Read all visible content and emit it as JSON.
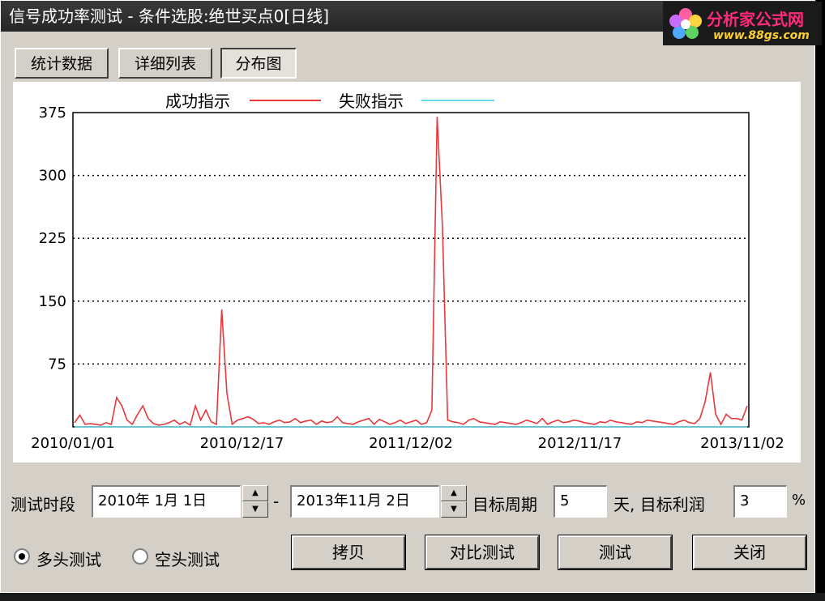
{
  "window": {
    "title": "信号成功率测试 - 条件选股:绝世买点0[日线]"
  },
  "watermark": {
    "brand": "分析家公式网",
    "url": "www.88gs.com"
  },
  "tabs": [
    {
      "label": "统计数据",
      "active": false
    },
    {
      "label": "详细列表",
      "active": false
    },
    {
      "label": "分布图",
      "active": true
    }
  ],
  "chart": {
    "legend": {
      "success": "成功指示",
      "fail": "失败指示"
    },
    "yticks": [
      "375",
      "300",
      "225",
      "150",
      "75"
    ],
    "xticks": [
      "2010/01/01",
      "2010/12/17",
      "2011/12/02",
      "2012/11/17",
      "2013/11/02"
    ]
  },
  "chart_data": {
    "type": "line",
    "ylim": [
      0,
      375
    ],
    "grid": true,
    "legend_position": "top",
    "x": [
      "2010/01/01",
      "2010/12/17",
      "2011/12/02",
      "2012/11/17",
      "2013/11/02"
    ],
    "series": [
      {
        "name": "成功指示",
        "color": "#e8383c",
        "values": [
          5,
          14,
          3,
          4,
          3,
          2,
          5,
          3,
          35,
          25,
          8,
          3,
          15,
          25,
          10,
          4,
          2,
          3,
          5,
          8,
          3,
          6,
          2,
          25,
          8,
          20,
          6,
          3,
          140,
          40,
          3,
          8,
          10,
          12,
          9,
          4,
          5,
          3,
          6,
          8,
          5,
          6,
          10,
          5,
          7,
          8,
          3,
          7,
          5,
          6,
          12,
          5,
          4,
          3,
          6,
          8,
          10,
          3,
          9,
          6,
          3,
          5,
          8,
          4,
          6,
          8,
          3,
          5,
          20,
          370,
          240,
          8,
          6,
          5,
          3,
          8,
          10,
          6,
          5,
          4,
          3,
          6,
          5,
          4,
          3,
          5,
          8,
          6,
          4,
          10,
          3,
          6,
          8,
          5,
          6,
          8,
          7,
          5,
          4,
          3,
          6,
          5,
          8,
          6,
          5,
          4,
          3,
          6,
          5,
          8,
          7,
          6,
          5,
          4,
          3,
          6,
          8,
          5,
          4,
          10,
          30,
          65,
          15,
          3,
          15,
          10,
          10,
          8,
          25
        ]
      },
      {
        "name": "失败指示",
        "color": "#63dcea",
        "values": [
          0,
          0,
          0,
          0,
          0,
          0,
          0,
          0,
          0,
          0,
          0,
          0,
          0,
          0,
          0,
          0,
          0,
          0,
          0,
          0,
          0,
          0,
          0,
          0,
          0,
          0,
          0,
          0,
          0,
          0,
          0,
          0,
          0,
          0,
          0,
          0,
          0,
          0,
          0,
          0,
          0,
          0,
          0,
          0,
          0,
          0,
          0,
          0,
          0,
          0,
          0,
          0,
          0,
          0,
          0,
          0,
          0,
          0,
          0,
          0,
          0,
          0,
          0,
          0,
          0,
          0,
          0,
          0,
          0,
          0,
          0,
          0,
          0,
          0,
          0,
          0,
          0,
          0,
          0,
          0,
          0,
          0,
          0,
          0,
          0,
          0,
          0,
          0,
          0,
          0,
          0,
          0,
          0,
          0,
          0,
          0,
          0,
          0,
          0,
          0,
          0,
          0,
          0,
          0,
          0,
          0,
          0,
          0,
          0,
          0,
          0,
          0,
          0,
          0,
          0,
          0,
          0,
          0,
          0,
          0,
          0,
          0,
          0,
          0,
          0,
          0,
          0,
          0
        ]
      }
    ]
  },
  "form": {
    "period_label": "测试时段",
    "start_date": "2010年 1月 1日",
    "dash": "-",
    "end_date": "2013年11月 2日",
    "target_period_label": "目标周期",
    "target_period_value": "5",
    "days_label": "天, 目标利润",
    "profit_value": "3",
    "percent": "%",
    "long_label": "多头测试",
    "short_label": "空头测试",
    "long_checked": true
  },
  "buttons": {
    "copy": "拷贝",
    "compare": "对比测试",
    "test": "测试",
    "close": "关闭"
  },
  "colors": {
    "titlebar": "#2e2e2e",
    "panel": "#d4d0c8",
    "success": "#e8383c",
    "fail": "#63dcea"
  }
}
